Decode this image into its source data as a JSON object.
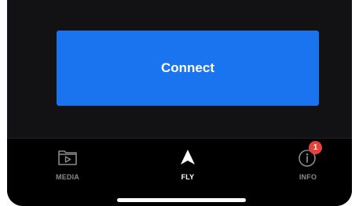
{
  "main": {
    "connect_label": "Connect"
  },
  "tabbar": {
    "tabs": [
      {
        "label": "MEDIA",
        "icon": "media-folder-icon",
        "active": false
      },
      {
        "label": "FLY",
        "icon": "fly-arrow-icon",
        "active": true
      },
      {
        "label": "INFO",
        "icon": "info-icon",
        "active": false,
        "badge": "1"
      }
    ]
  },
  "colors": {
    "background": "#121214",
    "tabbar": "#000000",
    "accent": "#1a74f0",
    "badge": "#e8413a",
    "inactive_label": "#8a8a8e"
  }
}
